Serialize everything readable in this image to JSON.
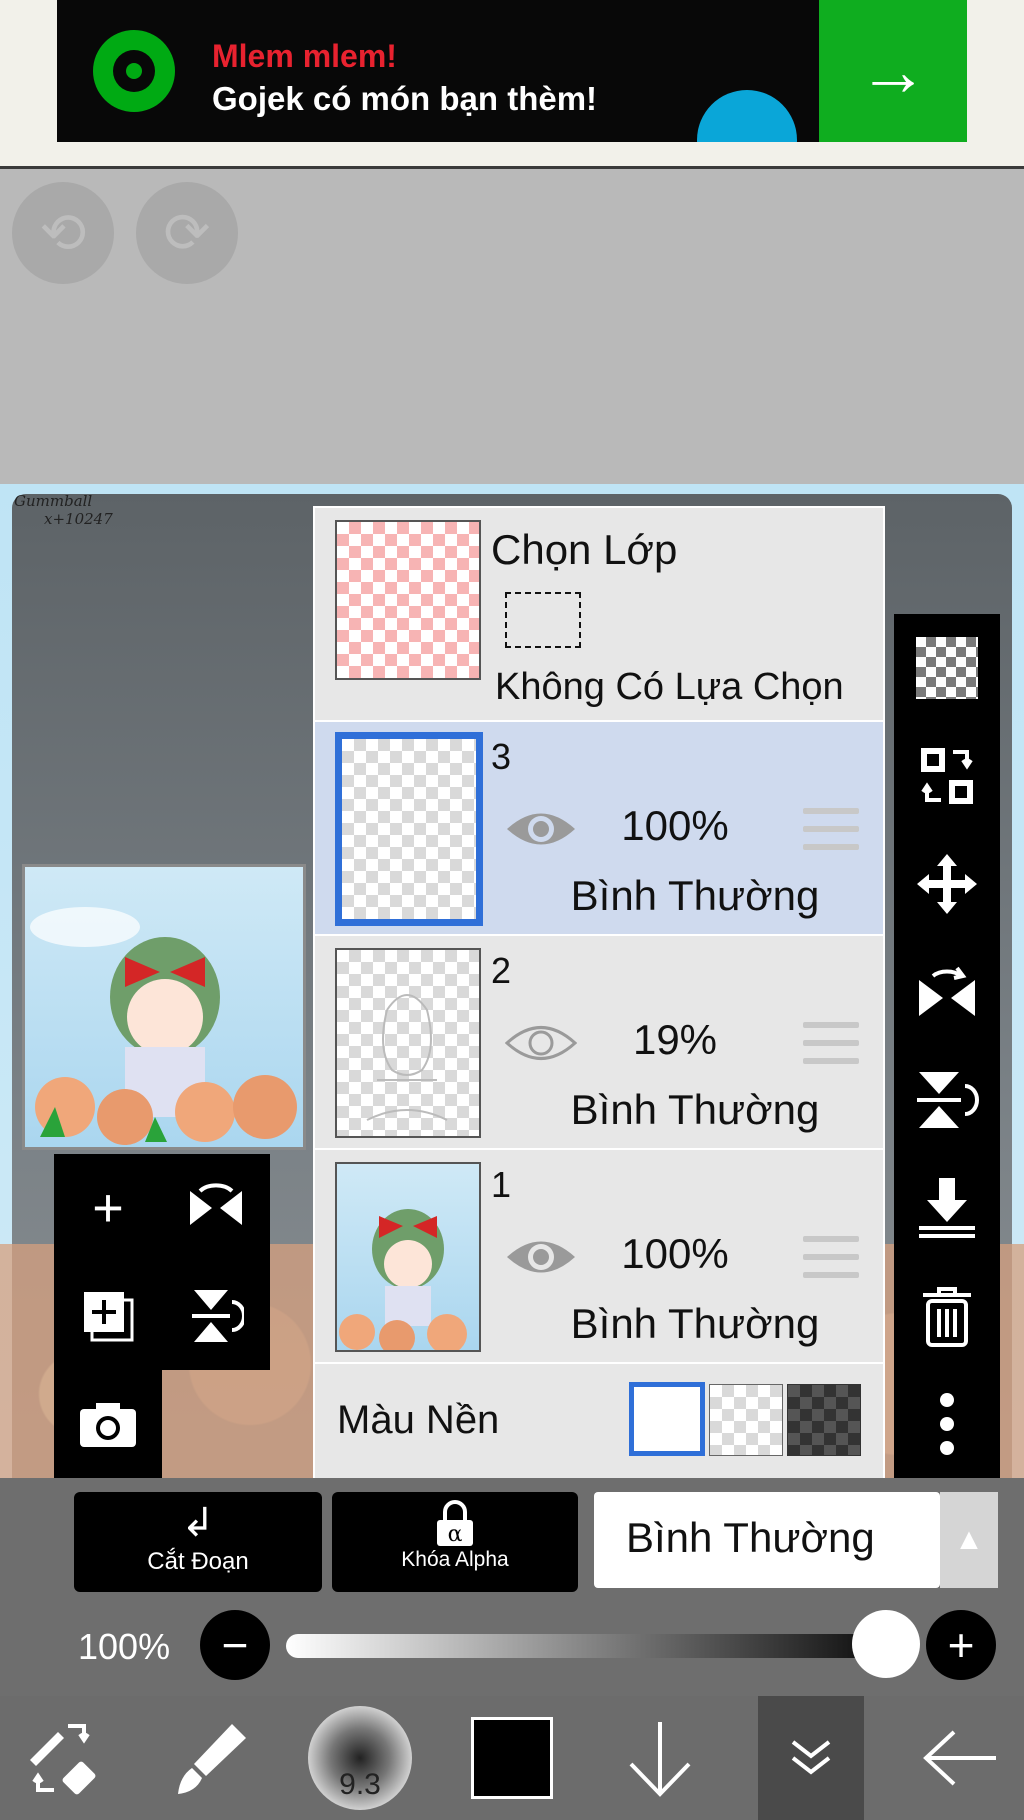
{
  "ad": {
    "line1": "Mlem mlem!",
    "line2": "Gojek có món bạn thèm!",
    "brand_color": "#00aa13"
  },
  "history": {
    "undo_icon": "undo-icon",
    "redo_icon": "redo-icon"
  },
  "canvas": {
    "signature_line1": "Gummball",
    "signature_line2": "x+10247"
  },
  "layers_panel": {
    "selection": {
      "title": "Chọn Lớp",
      "status": "Không Có Lựa Chọn"
    },
    "layers": [
      {
        "number": "3",
        "opacity": "100%",
        "blend": "Bình Thường",
        "selected": true,
        "visible": true
      },
      {
        "number": "2",
        "opacity": "19%",
        "blend": "Bình Thường",
        "selected": false,
        "visible": false
      },
      {
        "number": "1",
        "opacity": "100%",
        "blend": "Bình Thường",
        "selected": false,
        "visible": true
      }
    ],
    "background": {
      "label": "Màu Nền",
      "options": [
        "white",
        "transparent",
        "dark-checker"
      ],
      "selected": "white"
    }
  },
  "right_toolbar": [
    "transparent-layer-icon",
    "layer-swap-icon",
    "move-icon",
    "flip-horizontal-icon",
    "flip-vertical-icon",
    "merge-down-icon",
    "trash-icon",
    "more-vertical-icon"
  ],
  "left_toolbar": [
    "add-layer-icon",
    "flip-horizontal-icon",
    "duplicate-layer-icon",
    "flip-vertical-icon",
    "camera-icon"
  ],
  "controls": {
    "clipping_label": "Cắt Đoạn",
    "alpha_lock_label": "Khóa Alpha",
    "blend_mode": "Bình Thường",
    "opacity_label": "100%",
    "opacity_value": 1.0
  },
  "bottom_toolbar": {
    "brush_size": "9.3",
    "color": "#000000",
    "icons": [
      "swap-tool-icon",
      "brush-icon",
      "brush-size-icon",
      "color-swatch",
      "arrow-down-icon",
      "collapse-icon",
      "back-icon"
    ]
  },
  "colors": {
    "selected_border": "#2f6fd8",
    "selected_row": "#cfdaee"
  }
}
